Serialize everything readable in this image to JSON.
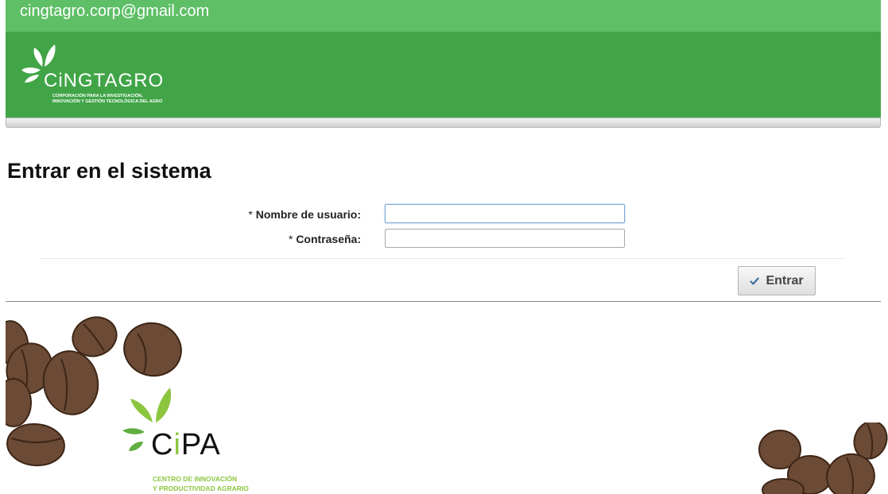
{
  "header": {
    "email": "cingtagro.corp@gmail.com",
    "logo": {
      "brand": "CiNGTAGRO",
      "tagline_line1": "CORPORACIÓN PARA LA INVESTIGACIÓN,",
      "tagline_line2": "INNOVACIÓN Y GESTIÓN TECNOLÓGICA DEL AGRO"
    },
    "colors": {
      "top": "#5ebf66",
      "banner": "#41a547"
    }
  },
  "login": {
    "title": "Entrar en el sistema",
    "required_mark": "*",
    "username_label": "Nombre de usuario:",
    "username_value": "",
    "password_label": "Contraseña:",
    "password_value": "",
    "submit_label": "Entrar",
    "submit_icon": "check-icon"
  },
  "footer": {
    "partner_logo": {
      "name_prefix": "C",
      "name_i": "i",
      "name_suffix": "PA",
      "subtitle_line1": "CENTRO DE INNOVACIÓN",
      "subtitle_line2": "Y PRODUCTIVIDAD AGRARIO",
      "accent": "#8cc63f"
    },
    "decoration": "coffee-beans"
  }
}
